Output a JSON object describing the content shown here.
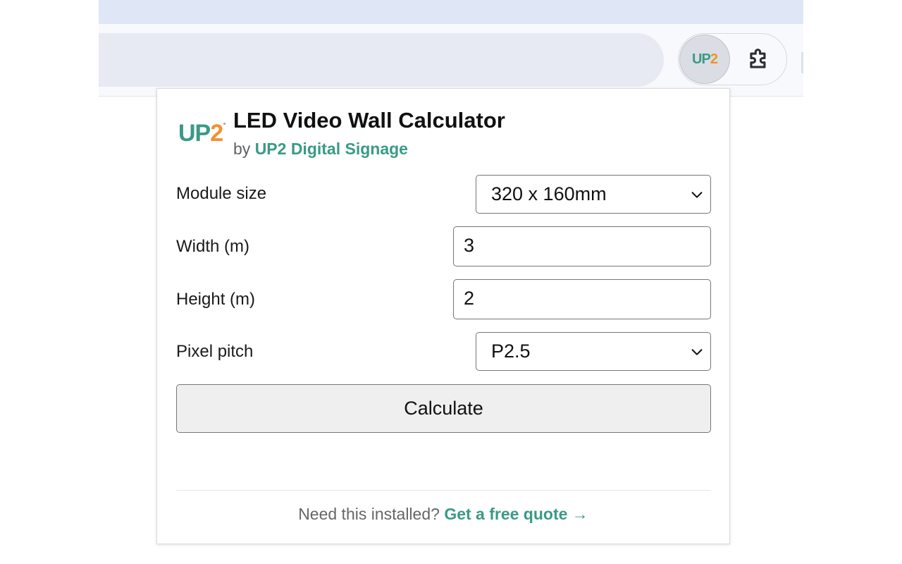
{
  "browser": {
    "extensions": {
      "active_extension_logo": {
        "part1": "UP",
        "part2": "2"
      },
      "puzzle_icon": "puzzle-icon"
    }
  },
  "popup": {
    "logo": {
      "part1": "UP",
      "part2": "2"
    },
    "title": "LED Video Wall Calculator",
    "byline_prefix": "by",
    "brand": "UP2 Digital Signage",
    "fields": {
      "module_size": {
        "label": "Module size",
        "value": "320 x 160mm"
      },
      "width": {
        "label": "Width (m)",
        "value": "3"
      },
      "height": {
        "label": "Height (m)",
        "value": "2"
      },
      "pixel_pitch": {
        "label": "Pixel pitch",
        "value": "P2.5"
      }
    },
    "calculate_label": "Calculate",
    "footer": {
      "prompt": "Need this installed?",
      "link_text": "Get a free quote →"
    }
  },
  "colors": {
    "brand_teal": "#3a9a86",
    "brand_orange": "#f0922b",
    "tab_strip": "#dfe6f6",
    "omnibox": "#e7eaf3"
  }
}
